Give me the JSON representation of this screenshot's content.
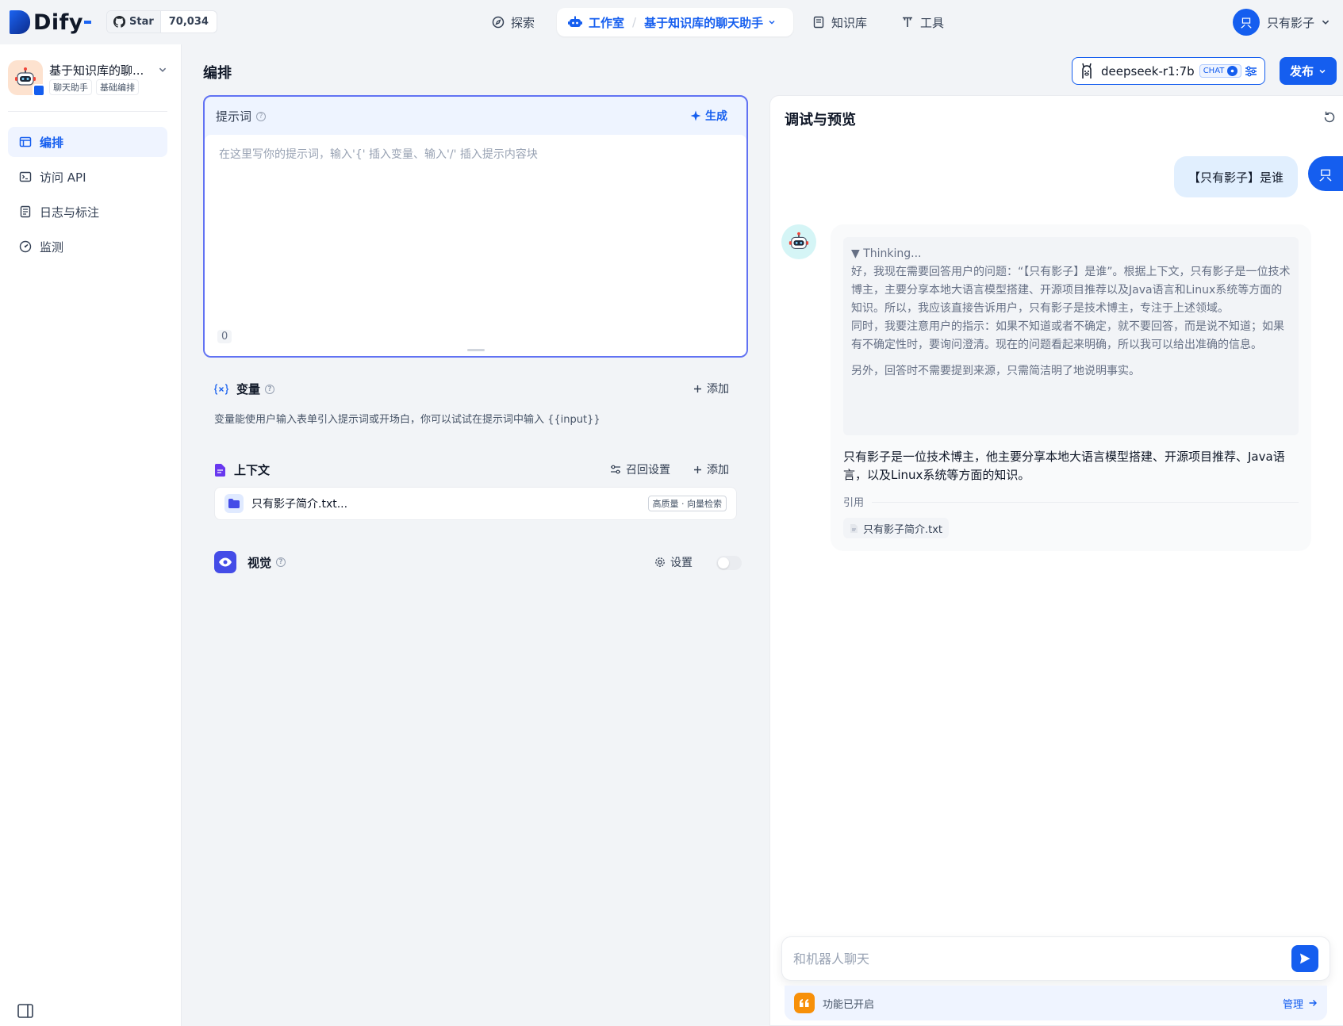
{
  "brand": {
    "name": "Dify",
    "accent": "#155eef"
  },
  "github": {
    "star_label": "Star",
    "count": "70,034"
  },
  "nav": {
    "explore": "探索",
    "studio": "工作室",
    "current_app": "基于知识库的聊天助手",
    "knowledge": "知识库",
    "tools": "工具"
  },
  "user": {
    "initial": "只",
    "name": "只有影子"
  },
  "sidebar": {
    "app_name": "基于知识库的聊...",
    "tags": [
      "聊天助手",
      "基础编排"
    ],
    "items": [
      {
        "label": "编排",
        "icon": "layout-icon",
        "active": true
      },
      {
        "label": "访问 API",
        "icon": "terminal-icon",
        "active": false
      },
      {
        "label": "日志与标注",
        "icon": "file-list-icon",
        "active": false
      },
      {
        "label": "监测",
        "icon": "dashboard-icon",
        "active": false
      }
    ]
  },
  "orchestrate": {
    "title": "编排",
    "model": {
      "name": "deepseek-r1:7b",
      "mode_tag": "CHAT"
    },
    "publish_label": "发布",
    "prompt": {
      "label": "提示词",
      "generate_label": "生成",
      "placeholder": "在这里写你的提示词，输入'{' 插入变量、输入'/' 插入提示内容块",
      "char_count": "0"
    },
    "variables": {
      "label": "变量",
      "add_label": "添加",
      "description": "变量能使用户输入表单引入提示词或开场白，你可以试试在提示词中输入 {{input}}"
    },
    "context": {
      "label": "上下文",
      "recall_label": "召回设置",
      "add_label": "添加",
      "dataset_name": "只有影子简介.txt...",
      "dataset_tag": "高质量 · 向量检索"
    },
    "vision": {
      "label": "视觉",
      "settings_label": "设置",
      "enabled": false
    }
  },
  "preview": {
    "title": "调试与预览",
    "user_message": "【只有影子】是谁",
    "thinking_header": "▼ Thinking...",
    "thinking_paragraphs": [
      "好，我现在需要回答用户的问题：“【只有影子】是谁”。根据上下文，只有影子是一位技术博主，主要分享本地大语言模型搭建、开源项目推荐以及Java语言和Linux系统等方面的知识。所以，我应该直接告诉用户，只有影子是技术博主，专注于上述领域。\n同时，我要注意用户的指示：如果不知道或者不确定，就不要回答，而是说不知道；如果有不确定性时，要询问澄清。现在的问题看起来明确，所以我可以给出准确的信息。",
      "另外，回答时不需要提到来源，只需简洁明了地说明事实。"
    ],
    "answer": "只有影子是一位技术博主，他主要分享本地大语言模型搭建、开源项目推荐、Java语言，以及Linux系统等方面的知识。",
    "citation_label": "引用",
    "citation_file": "只有影子简介.txt",
    "input_placeholder": "和机器人聊天",
    "features_label": "功能已开启",
    "manage_label": "管理"
  }
}
